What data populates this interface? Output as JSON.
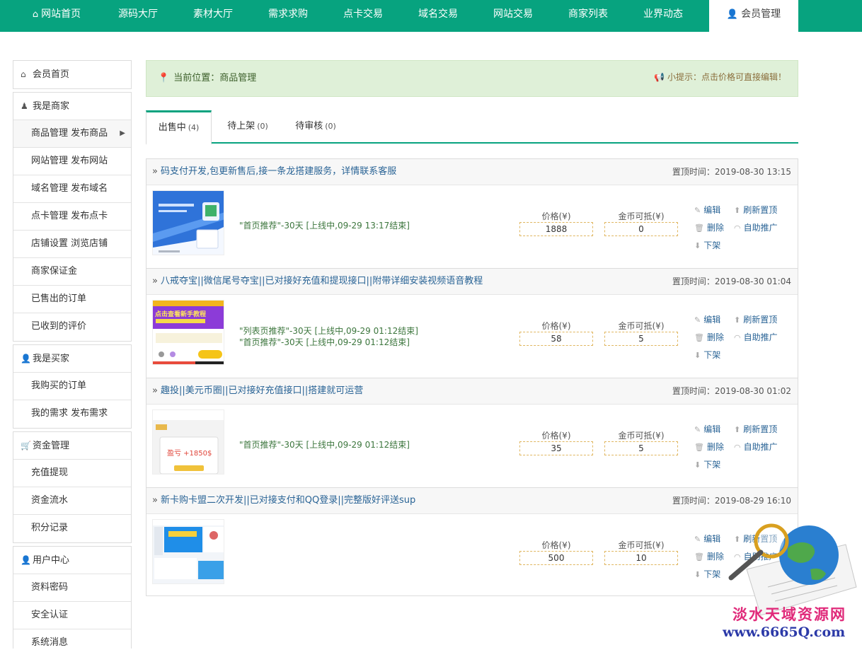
{
  "nav": {
    "items": [
      {
        "label": "网站首页",
        "icon": "home-icon"
      },
      {
        "label": "源码大厅"
      },
      {
        "label": "素材大厅"
      },
      {
        "label": "需求求购"
      },
      {
        "label": "点卡交易"
      },
      {
        "label": "域名交易"
      },
      {
        "label": "网站交易"
      },
      {
        "label": "商家列表"
      },
      {
        "label": "业界动态"
      },
      {
        "label": "会员管理",
        "icon": "user-icon",
        "active": true
      }
    ]
  },
  "sidebar": {
    "home": "会员首页",
    "merchant": {
      "title": "我是商家",
      "items": [
        "商品管理 发布商品",
        "网站管理 发布网站",
        "域名管理 发布域名",
        "点卡管理 发布点卡",
        "店铺设置 浏览店铺",
        "商家保证金",
        "已售出的订单",
        "已收到的评价"
      ]
    },
    "buyer": {
      "title": "我是买家",
      "items": [
        "我购买的订单",
        "我的需求 发布需求"
      ]
    },
    "funds": {
      "title": "资金管理",
      "items": [
        "充值提现",
        "资金流水",
        "积分记录"
      ]
    },
    "user": {
      "title": "用户中心",
      "items": [
        "资料密码",
        "安全认证",
        "系统消息"
      ]
    }
  },
  "breadcrumb": {
    "location": "当前位置：商品管理",
    "tip": "小提示：点击价格可直接编辑！"
  },
  "tabs": [
    {
      "label": "出售中",
      "count": "(4)"
    },
    {
      "label": "待上架",
      "count": "(0)"
    },
    {
      "label": "待审核",
      "count": "(0)"
    }
  ],
  "labels": {
    "price": "价格(¥)",
    "coin": "金币可抵(¥)",
    "edit": "编辑",
    "refresh": "刷新置顶",
    "delete": "删除",
    "promote": "自助推广",
    "offshelf": "下架"
  },
  "products": [
    {
      "title": "码支付开发,包更新售后,接一条龙搭建服务，详情联系客服",
      "time": "置顶时间：2019-08-30 13:15",
      "promos": [
        "\"首页推荐\"-30天 [上线中,09-29 13:17结束]"
      ],
      "price": "1888",
      "coin": "0"
    },
    {
      "title": "八戒夺宝||微信尾号夺宝||已对接好充值和提现接口||附带详细安装视频语音教程",
      "time": "置顶时间：2019-08-30 01:04",
      "promos": [
        "\"列表页推荐\"-30天 [上线中,09-29 01:12结束]",
        "\"首页推荐\"-30天 [上线中,09-29 01:12结束]"
      ],
      "price": "58",
      "coin": "5"
    },
    {
      "title": "趣投||美元币圈||已对接好充值接口||搭建就可运营",
      "time": "置顶时间：2019-08-30 01:02",
      "promos": [
        "\"首页推荐\"-30天 [上线中,09-29 01:12结束]"
      ],
      "price": "35",
      "coin": "5"
    },
    {
      "title": "新卡购卡盟二次开发||已对接支付和QQ登录||完整版好评送sup",
      "time": "置顶时间：2019-08-29 16:10",
      "promos": [],
      "price": "500",
      "coin": "10"
    }
  ],
  "thumb_text": {
    "p2_banner": "点击查看新手教程",
    "p3_profit": "盈亏 +1850$"
  },
  "watermark": {
    "text": "淡水天域资源网",
    "url": "www.6665Q.com"
  }
}
